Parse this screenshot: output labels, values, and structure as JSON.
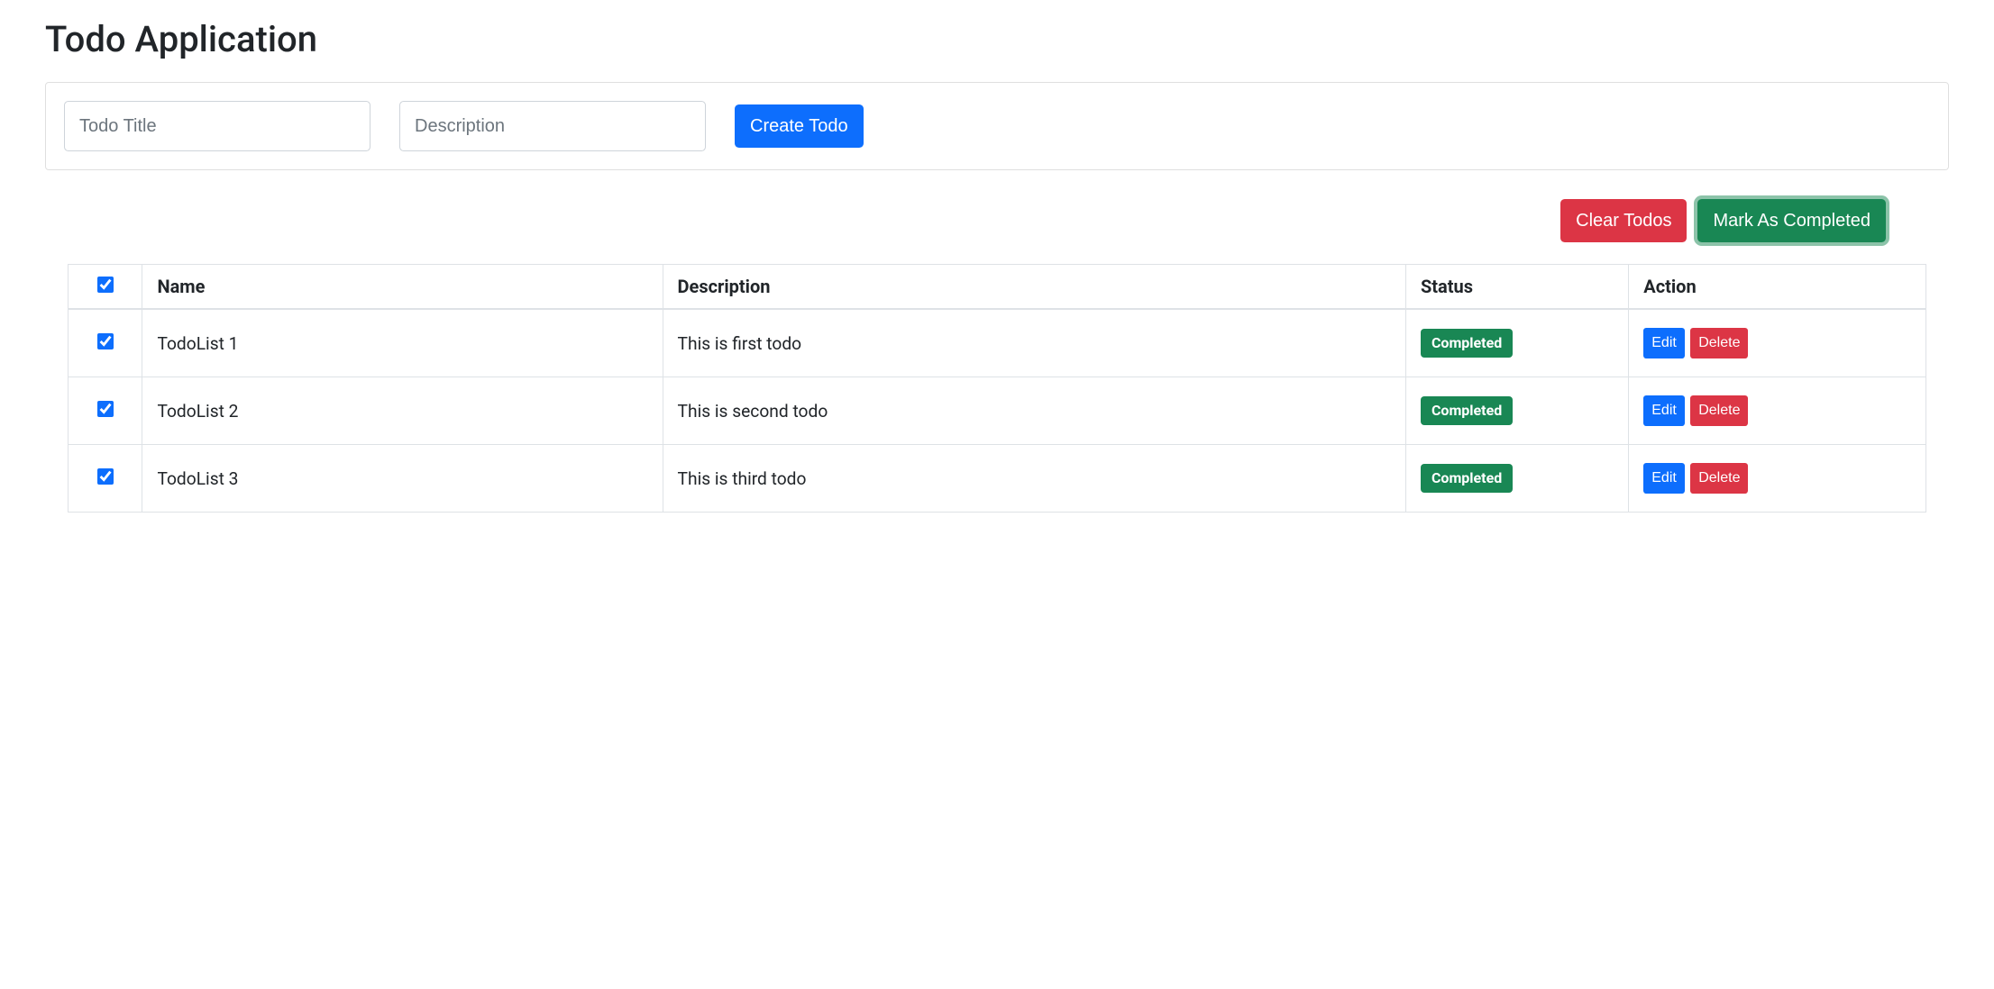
{
  "page": {
    "title": "Todo Application"
  },
  "form": {
    "title_placeholder": "Todo Title",
    "description_placeholder": "Description",
    "create_button": "Create Todo"
  },
  "actions": {
    "clear": "Clear Todos",
    "mark_completed": "Mark As Completed"
  },
  "table": {
    "headers": {
      "name": "Name",
      "description": "Description",
      "status": "Status",
      "action": "Action"
    },
    "select_all_checked": true,
    "buttons": {
      "edit": "Edit",
      "delete": "Delete"
    },
    "status_labels": {
      "completed": "Completed"
    },
    "rows": [
      {
        "checked": true,
        "name": "TodoList 1",
        "description": "This is first todo",
        "status": "Completed"
      },
      {
        "checked": true,
        "name": "TodoList 2",
        "description": "This is second todo",
        "status": "Completed"
      },
      {
        "checked": true,
        "name": "TodoList 3",
        "description": "This is third todo",
        "status": "Completed"
      }
    ]
  }
}
